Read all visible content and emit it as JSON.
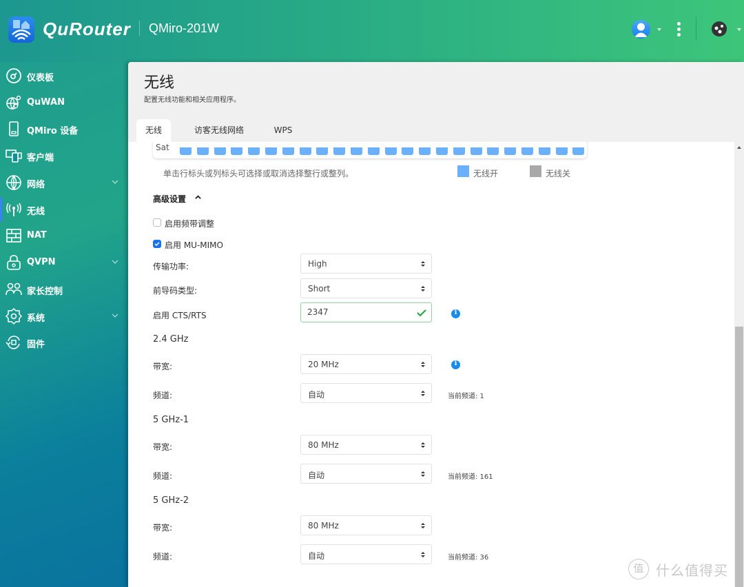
{
  "header": {
    "brand": "QuRouter",
    "device_name": "QMiro-201W"
  },
  "sidebar": {
    "items": [
      {
        "label": "仪表板",
        "icon": "dashboard-icon",
        "has_children": false,
        "active": false
      },
      {
        "label": "QuWAN",
        "icon": "quwan-globe-pin-icon",
        "has_children": false,
        "active": false
      },
      {
        "label": "QMiro 设备",
        "icon": "device-icon",
        "has_children": false,
        "active": false
      },
      {
        "label": "客户端",
        "icon": "clients-icon",
        "has_children": false,
        "active": false
      },
      {
        "label": "网络",
        "icon": "globe-icon",
        "has_children": true,
        "active": false
      },
      {
        "label": "无线",
        "icon": "wireless-antenna-icon",
        "has_children": false,
        "active": true
      },
      {
        "label": "NAT",
        "icon": "firewall-brick-icon",
        "has_children": false,
        "active": false
      },
      {
        "label": "QVPN",
        "icon": "lock-icon",
        "has_children": true,
        "active": false
      },
      {
        "label": "家长控制",
        "icon": "parental-users-icon",
        "has_children": false,
        "active": false
      },
      {
        "label": "系统",
        "icon": "gear-icon",
        "has_children": true,
        "active": false
      },
      {
        "label": "固件",
        "icon": "firmware-refresh-icon",
        "has_children": false,
        "active": false
      }
    ]
  },
  "page": {
    "title": "无线",
    "description": "配置无线功能和相关应用程序。",
    "tabs": [
      {
        "label": "无线",
        "active": true
      },
      {
        "label": "访客无线网络",
        "active": false
      },
      {
        "label": "WPS",
        "active": false
      }
    ]
  },
  "schedule": {
    "row_label": "Sat",
    "hours": [
      1,
      1,
      1,
      1,
      1,
      1,
      1,
      1,
      1,
      1,
      1,
      1,
      1,
      1,
      1,
      1,
      1,
      1,
      1,
      1,
      1,
      1,
      1,
      1
    ],
    "hint": "单击行标头或列标头可选择或取消选择整行或整列。",
    "legend_on": "无线开",
    "legend_off": "无线关",
    "color_on": "#6ab0fb",
    "color_off": "#a9a9a9"
  },
  "advanced": {
    "title": "高级设置",
    "band_steering": {
      "label": "启用频带调整",
      "checked": false
    },
    "mu_mimo": {
      "label": "启用 MU-MIMO",
      "checked": true
    },
    "tx_power": {
      "label": "传输功率:",
      "value": "High"
    },
    "preamble": {
      "label": "前导码类型:",
      "value": "Short"
    },
    "cts_rts": {
      "label": "启用 CTS/RTS",
      "value": "2347"
    }
  },
  "bands": [
    {
      "title": "2.4 GHz",
      "bandwidth_label": "带宽:",
      "bandwidth": "20 MHz",
      "channel_label": "频道:",
      "channel": "自动",
      "current_channel": "当前频道: 1",
      "bandwidth_info": true
    },
    {
      "title": "5 GHz-1",
      "bandwidth_label": "带宽:",
      "bandwidth": "80 MHz",
      "channel_label": "频道:",
      "channel": "自动",
      "current_channel": "当前频道: 161",
      "bandwidth_info": false
    },
    {
      "title": "5 GHz-2",
      "bandwidth_label": "带宽:",
      "bandwidth": "80 MHz",
      "channel_label": "频道:",
      "channel": "自动",
      "current_channel": "当前频道: 36",
      "bandwidth_info": false
    }
  ],
  "watermark": {
    "icon_glyph": "值",
    "text": "什么值得买"
  }
}
